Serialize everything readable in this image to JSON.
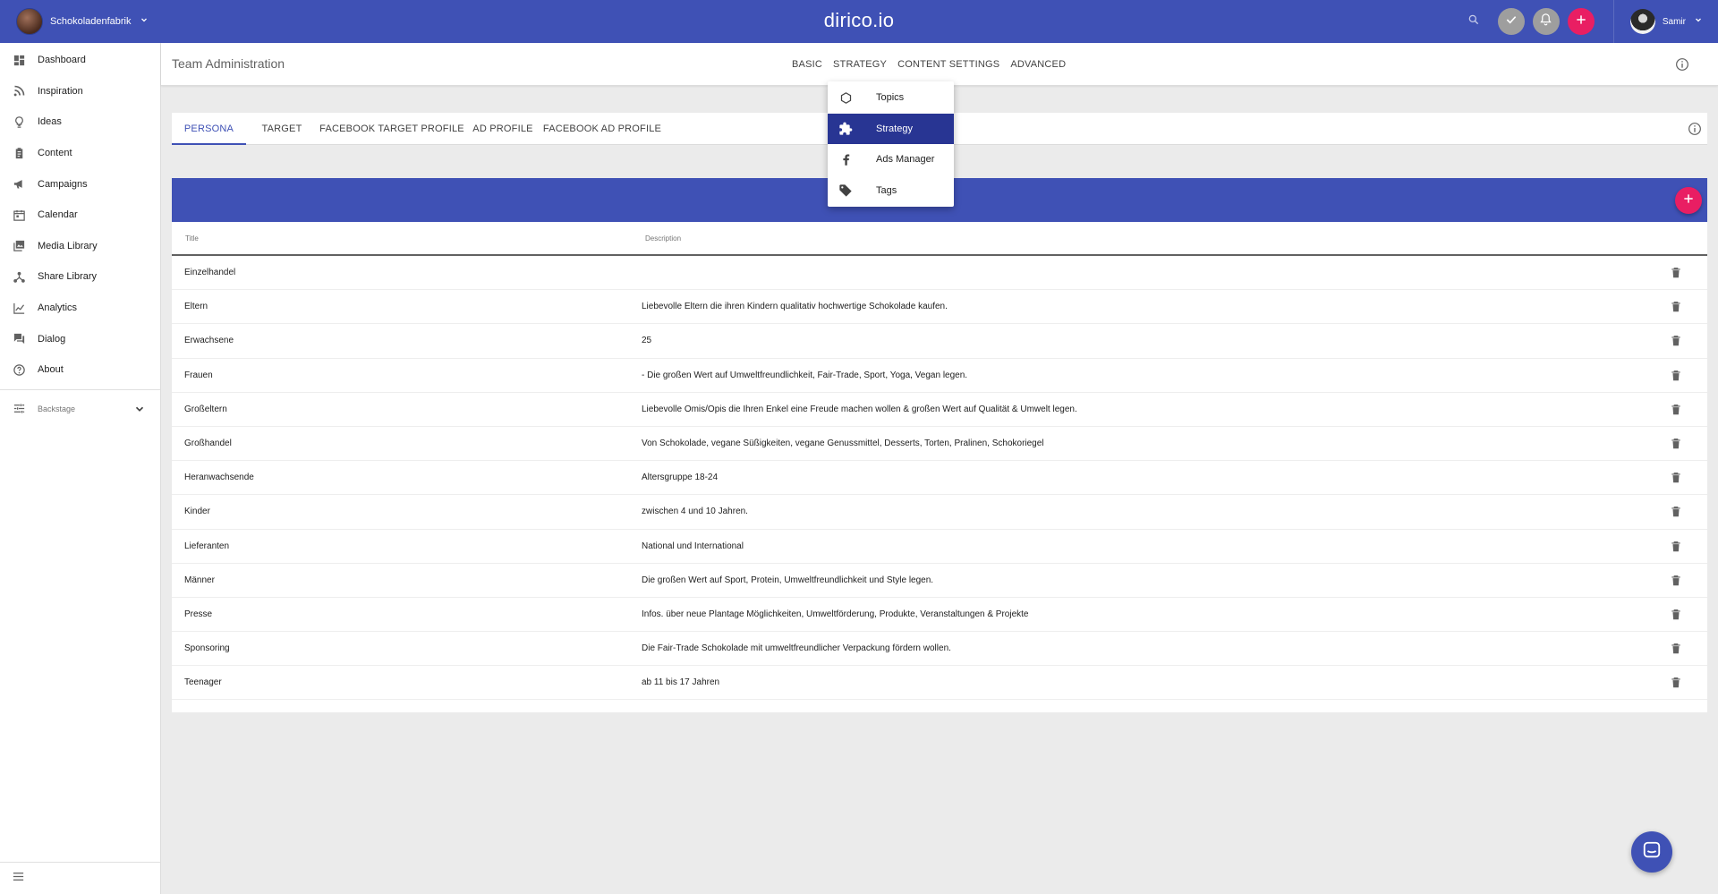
{
  "header": {
    "workspace_name": "Schokoladenfabrik",
    "brand": "dirico.io",
    "user_name": "Samir"
  },
  "sidebar": {
    "items": [
      {
        "label": "Dashboard",
        "icon": "dashboard-icon"
      },
      {
        "label": "Inspiration",
        "icon": "rss-icon"
      },
      {
        "label": "Ideas",
        "icon": "lightbulb-icon"
      },
      {
        "label": "Content",
        "icon": "clipboard-icon"
      },
      {
        "label": "Campaigns",
        "icon": "megaphone-icon"
      },
      {
        "label": "Calendar",
        "icon": "calendar-icon"
      },
      {
        "label": "Media Library",
        "icon": "photo-library-icon"
      },
      {
        "label": "Share Library",
        "icon": "share-icon"
      },
      {
        "label": "Analytics",
        "icon": "chart-line-icon"
      },
      {
        "label": "Dialog",
        "icon": "forum-icon"
      },
      {
        "label": "About",
        "icon": "help-circle-icon"
      }
    ],
    "backstage_label": "Backstage"
  },
  "page": {
    "title": "Team Administration",
    "tabs": [
      "BASIC",
      "STRATEGY",
      "CONTENT SETTINGS",
      "ADVANCED"
    ]
  },
  "strategy_menu": {
    "items": [
      {
        "label": "Topics",
        "icon": "hexagon-icon",
        "active": false
      },
      {
        "label": "Strategy",
        "icon": "puzzle-icon",
        "active": true
      },
      {
        "label": "Ads Manager",
        "icon": "facebook-icon",
        "active": false
      },
      {
        "label": "Tags",
        "icon": "tag-icon",
        "active": false
      }
    ]
  },
  "subtabs": [
    "PERSONA",
    "TARGET",
    "FACEBOOK TARGET PROFILE",
    "AD PROFILE",
    "FACEBOOK AD PROFILE"
  ],
  "table": {
    "columns": [
      "Title",
      "Description"
    ],
    "rows": [
      {
        "title": "Einzelhandel",
        "description": ""
      },
      {
        "title": "Eltern",
        "description": "Liebevolle Eltern die ihren Kindern qualitativ hochwertige Schokolade kaufen."
      },
      {
        "title": "Erwachsene",
        "description": "25"
      },
      {
        "title": "Frauen",
        "description": "- Die großen Wert auf Umweltfreundlichkeit, Fair-Trade, Sport, Yoga, Vegan legen."
      },
      {
        "title": "Großeltern",
        "description": "Liebevolle Omis/Opis die Ihren Enkel eine Freude machen wollen & großen Wert auf Qualität & Umwelt legen."
      },
      {
        "title": "Großhandel",
        "description": "Von Schokolade, vegane Süßigkeiten, vegane Genussmittel, Desserts, Torten, Pralinen, Schokoriegel"
      },
      {
        "title": "Heranwachsende",
        "description": "Altersgruppe 18-24"
      },
      {
        "title": "Kinder",
        "description": "zwischen 4 und 10 Jahren."
      },
      {
        "title": "Lieferanten",
        "description": "National und International"
      },
      {
        "title": "Männer",
        "description": "Die großen Wert auf Sport, Protein, Umweltfreundlichkeit und Style legen."
      },
      {
        "title": "Presse",
        "description": "Infos. über neue Plantage Möglichkeiten, Umweltförderung, Produkte, Veranstaltungen & Projekte"
      },
      {
        "title": "Sponsoring",
        "description": "Die Fair-Trade Schokolade mit umweltfreundlicher Verpackung fördern wollen."
      },
      {
        "title": "Teenager",
        "description": "ab 11 bis 17 Jahren"
      }
    ]
  },
  "colors": {
    "primary": "#3f51b5",
    "primary_dark": "#283593",
    "accent": "#e91e63",
    "neutral_button": "#9e9e9e"
  }
}
